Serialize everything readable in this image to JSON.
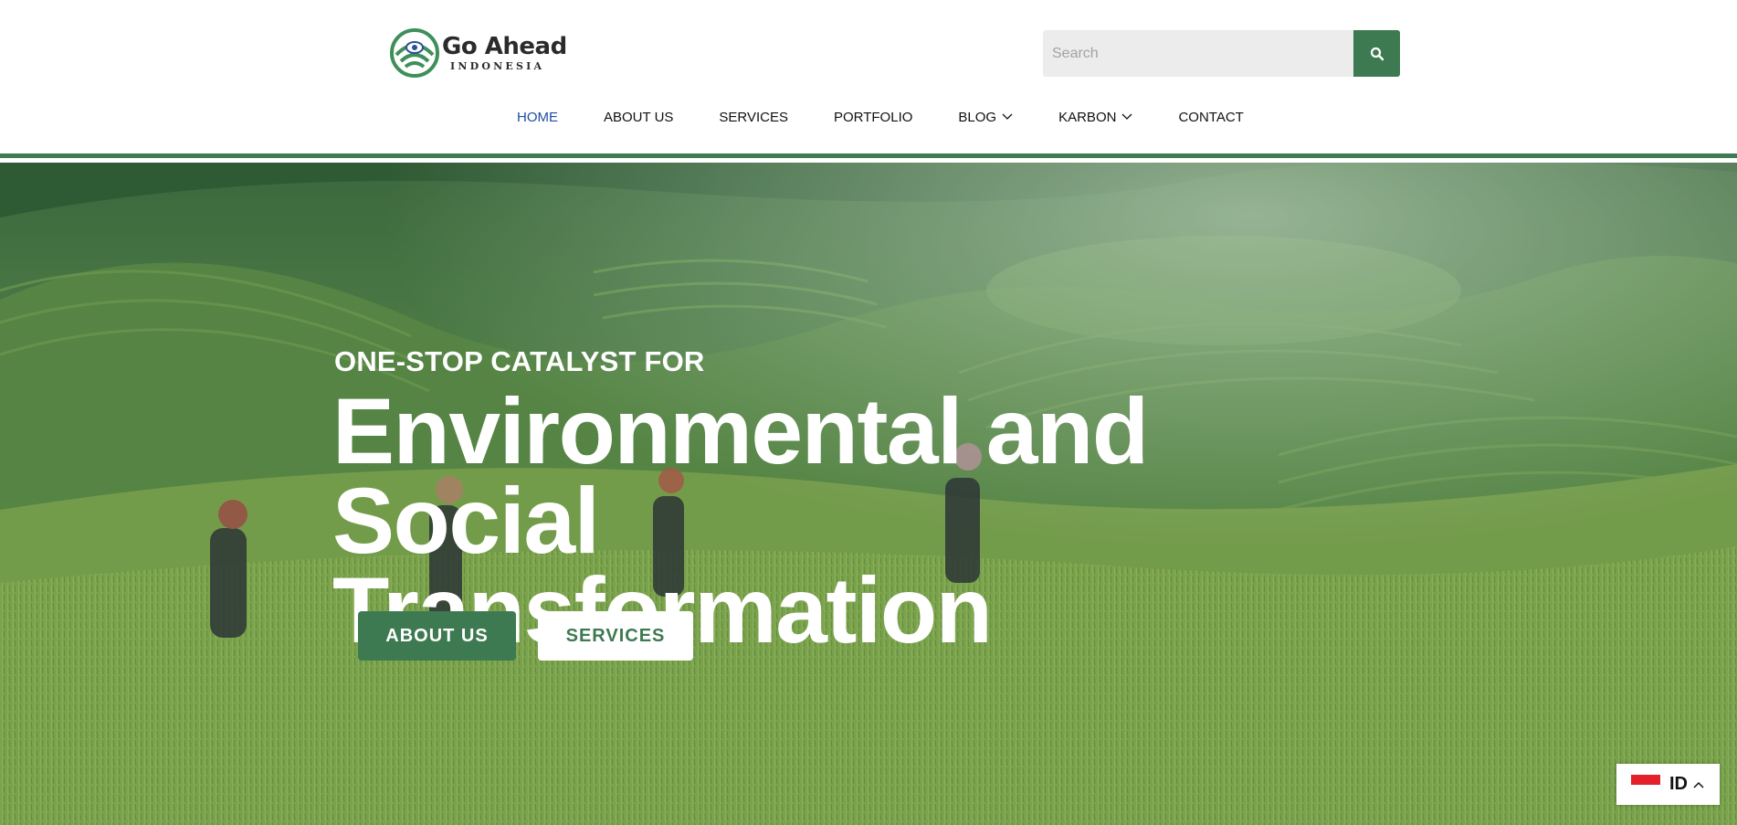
{
  "brand": {
    "name": "Go Ahead",
    "subtitle": "INDONESIA",
    "accent_color": "#3e7a51",
    "logo_icon": "leaf-eye-logo-icon"
  },
  "search": {
    "placeholder": "Search",
    "value": "",
    "button_icon": "search-icon"
  },
  "nav": {
    "items": [
      {
        "label": "HOME",
        "active": true
      },
      {
        "label": "ABOUT US"
      },
      {
        "label": "SERVICES"
      },
      {
        "label": "PORTFOLIO"
      },
      {
        "label": "BLOG",
        "dropdown": true
      },
      {
        "label": "KARBON",
        "dropdown": true
      },
      {
        "label": "CONTACT"
      }
    ],
    "active_color": "#1f4ea3"
  },
  "hero": {
    "eyebrow": "ONE-STOP CATALYST FOR",
    "headline_line1": "Environmental and Social",
    "headline_line2": "Transformation",
    "primary_button": "ABOUT US",
    "secondary_button": "SERVICES",
    "background": "rice-terrace-photo"
  },
  "language": {
    "code": "ID",
    "flag": "indonesia-flag-icon",
    "chevron": "chevron-up-icon"
  }
}
